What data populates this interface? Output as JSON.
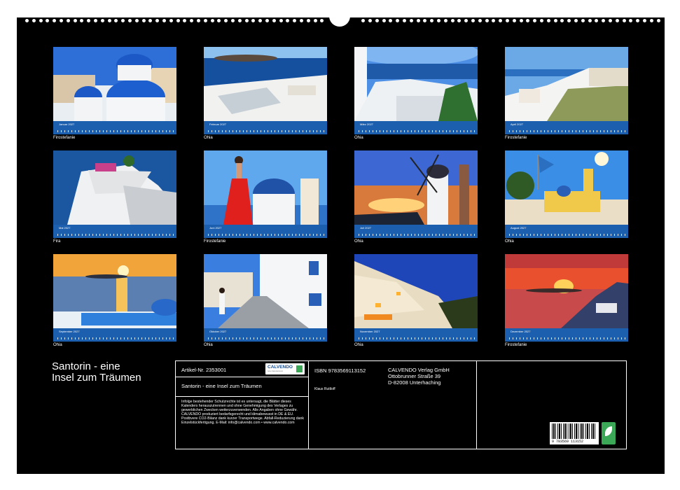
{
  "title": "Santorin - eine Insel zum Träumen",
  "title_lines": [
    "Santorin - eine",
    "Insel zum Träumen"
  ],
  "months": [
    {
      "label": "Januar 2027",
      "credit": "Firostefanie",
      "scene": "domes"
    },
    {
      "label": "Februar 2027",
      "credit": "Ohia",
      "scene": "caldera"
    },
    {
      "label": "März 2027",
      "credit": "Ohia",
      "scene": "terrace"
    },
    {
      "label": "April 2027",
      "credit": "Firostefanie",
      "scene": "village"
    },
    {
      "label": "Mai 2027",
      "credit": "Fira",
      "scene": "cliff"
    },
    {
      "label": "Juni 2027",
      "credit": "Firostefanie",
      "scene": "woman"
    },
    {
      "label": "Juli 2027",
      "credit": "Ohia",
      "scene": "windmill"
    },
    {
      "label": "August 2027",
      "credit": "Ohia",
      "scene": "church"
    },
    {
      "label": "September 2027",
      "credit": "Ohia",
      "scene": "sunset-pool"
    },
    {
      "label": "Oktober 2027",
      "credit": "Ohia",
      "scene": "alley"
    },
    {
      "label": "November 2027",
      "credit": "Ohia",
      "scene": "night-town"
    },
    {
      "label": "Dezember 2027",
      "credit": "Firostefanie",
      "scene": "red-sunset"
    }
  ],
  "info": {
    "article_no": "Artikel-Nr. 2353001",
    "product_title": "Santorin - eine Insel zum Träumen",
    "legal_text": "Infolge bestehender Schutzrechte ist es untersagt, die Blätter dieses Kalenders herauszutrennen und ohne Genehmigung des Verlages zu gewerblichen Zwecken weiterzuverwenden. Alle Angaben ohne Gewähr. CALVENDO produziert bedarfsgerecht und klimabewusst in DE & EU. Postbvere CO2-Bilanz dank kurzer Transportwege. Abfall-Reduzierung dank Einzelstückfertigung. E-Mail: info@calvendo.com • www.calvendo.com",
    "isbn": "ISBN 9783569113152",
    "author": "Klaus Ruttloff",
    "publisher": [
      "CALVENDO Verlag GmbH",
      "Ottobrunner Straße 39",
      "D-82008 Unterhaching"
    ],
    "barcode_number": "9 783569 113152",
    "logo_text": "CALVENDO",
    "logo_subtext": "feine Kalenderkunst"
  },
  "colors": {
    "background": "#000000",
    "calendar_strip": "#1c5fae",
    "text": "#ffffff"
  }
}
